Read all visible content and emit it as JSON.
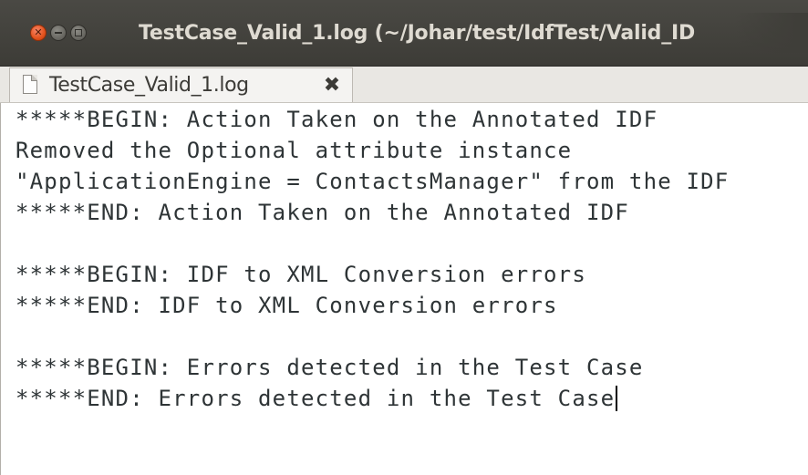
{
  "window": {
    "title": "TestCase_Valid_1.log (~/Johar/test/IdfTest/Valid_ID",
    "close_icon": "close-icon",
    "minimize_icon": "minimize-icon",
    "maximize_icon": "maximize-icon"
  },
  "tab": {
    "icon": "document-icon",
    "label": "TestCase_Valid_1.log",
    "close_glyph": "✖"
  },
  "editor": {
    "lines": [
      "*****BEGIN: Action Taken on the Annotated IDF",
      "Removed the Optional attribute instance",
      "\"ApplicationEngine = ContactsManager\" from the IDF",
      "*****END: Action Taken on the Annotated IDF",
      "",
      "*****BEGIN: IDF to XML Conversion errors",
      "*****END: IDF to XML Conversion errors",
      "",
      "*****BEGIN: Errors detected in the Test Case",
      "*****END: Errors detected in the Test Case"
    ]
  },
  "colors": {
    "titlebar": "#3f3e39",
    "close_button": "#e2521c",
    "text": "#2e3436"
  }
}
